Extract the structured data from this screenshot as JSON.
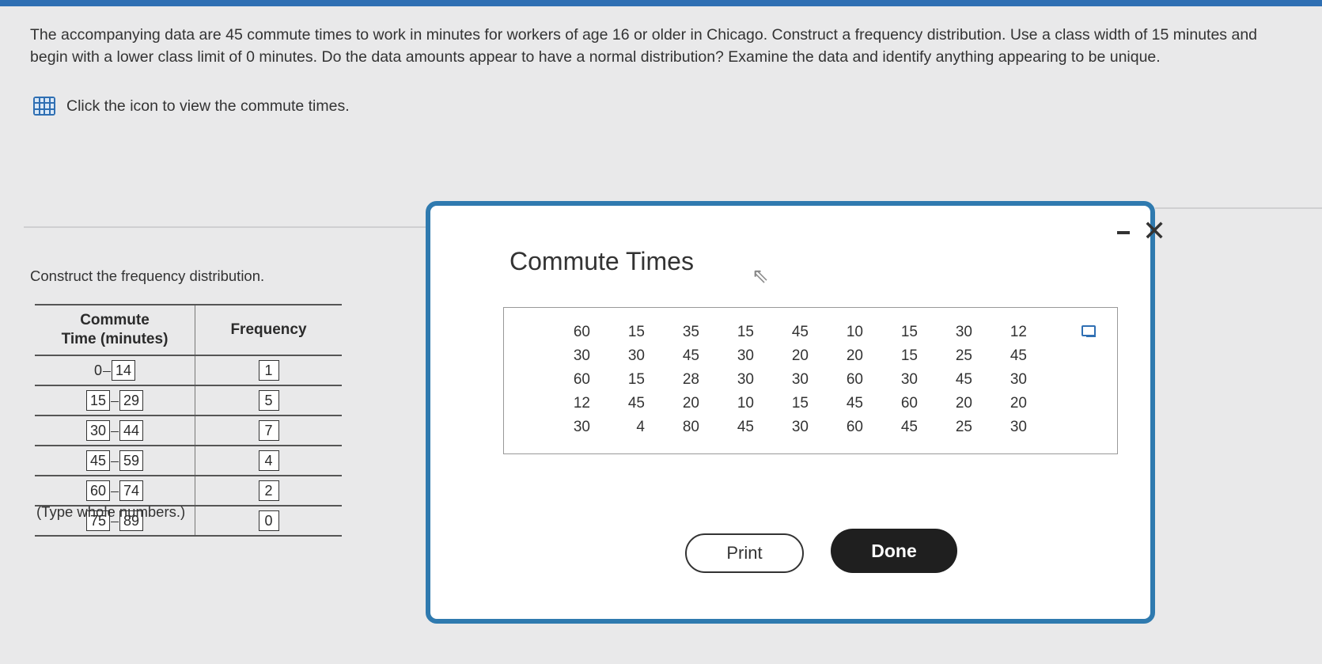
{
  "problem": {
    "text": "The accompanying data are 45 commute times to work in minutes for workers of age 16 or older in Chicago. Construct a frequency distribution. Use a class width of 15 minutes and begin with a lower class limit of 0 minutes. Do the data amounts appear to have a normal distribution? Examine the data and identify anything appearing to be unique.",
    "view_link": "Click the icon to view the commute times."
  },
  "left": {
    "construct_label": "Construct the frequency distribution.",
    "col1_line1": "Commute",
    "col1_line2": "Time (minutes)",
    "col2": "Frequency",
    "rows": [
      {
        "lower": "0",
        "upper": "14",
        "freq": "1"
      },
      {
        "lower": "15",
        "upper": "29",
        "freq": "5"
      },
      {
        "lower": "30",
        "upper": "44",
        "freq": "7"
      },
      {
        "lower": "45",
        "upper": "59",
        "freq": "4"
      },
      {
        "lower": "60",
        "upper": "74",
        "freq": "2"
      },
      {
        "lower": "75",
        "upper": "89",
        "freq": "0"
      }
    ],
    "note": "(Type whole numbers.)"
  },
  "modal": {
    "title": "Commute Times",
    "minimize": "–",
    "close": "✕",
    "data": [
      [
        "60",
        "15",
        "35",
        "15",
        "45",
        "10",
        "15",
        "30",
        "12"
      ],
      [
        "30",
        "30",
        "45",
        "30",
        "20",
        "20",
        "15",
        "25",
        "45"
      ],
      [
        "60",
        "15",
        "28",
        "30",
        "30",
        "60",
        "30",
        "45",
        "30"
      ],
      [
        "12",
        "45",
        "20",
        "10",
        "15",
        "45",
        "60",
        "20",
        "20"
      ],
      [
        "30",
        "4",
        "80",
        "45",
        "30",
        "60",
        "45",
        "25",
        "30"
      ]
    ],
    "print_label": "Print",
    "done_label": "Done"
  }
}
